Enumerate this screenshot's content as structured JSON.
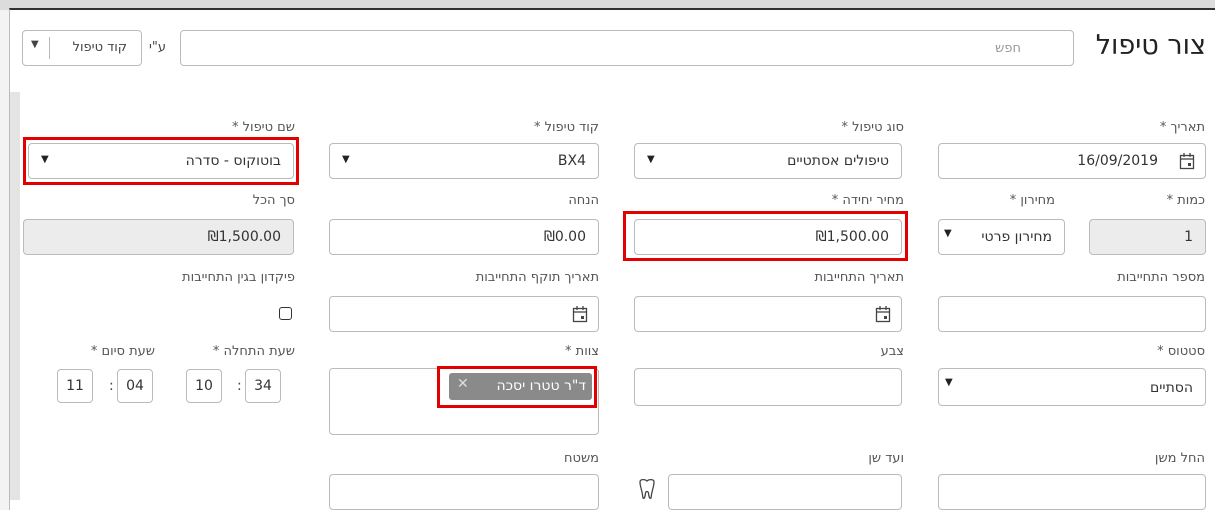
{
  "header": {
    "title": "צור טיפול",
    "search_placeholder": "חפש",
    "by_label": "ע\"י",
    "code_selector": "קוד טיפול"
  },
  "row1": {
    "date_label": "תאריך *",
    "date_value": "16/09/2019",
    "treatment_type_label": "סוג טיפול *",
    "treatment_type_value": "טיפולים אסתטיים",
    "treatment_code_label": "קוד טיפול *",
    "treatment_code_value": "BX4",
    "treatment_name_label": "שם טיפול *",
    "treatment_name_value": "בוטוקוס - סדרה"
  },
  "row2": {
    "quantity_label": "כמות *",
    "quantity_value": "1",
    "pricelist_label": "מחירון *",
    "pricelist_value": "מחירון פרטי",
    "unit_price_label": "מחיר יחידה *",
    "unit_price_value": "₪1,500.00",
    "discount_label": "הנחה",
    "discount_value": "₪0.00",
    "total_label": "סך הכל",
    "total_value": "₪1,500.00"
  },
  "row3": {
    "commitment_number_label": "מספר התחייבות",
    "commitment_date_label": "תאריך התחייבות",
    "commitment_expiry_label": "תאריך תוקף התחייבות",
    "deposit_label": "פיקדון בגין התחייבות"
  },
  "row4": {
    "status_label": "סטטוס *",
    "status_value": "הסתיים",
    "color_label": "צבע",
    "staff_label": "צוות *",
    "staff_tag": "ד\"ר טטרו יסכה",
    "start_time_label": "שעת התחלה *",
    "end_time_label": "שעת סיום *",
    "start_hour": "10",
    "start_minute": "34",
    "end_hour": "11",
    "end_minute": "04"
  },
  "row5": {
    "tooth_section_label": "החל משן",
    "to_tooth_label": "ועד שן",
    "surface_label": "משטח"
  }
}
